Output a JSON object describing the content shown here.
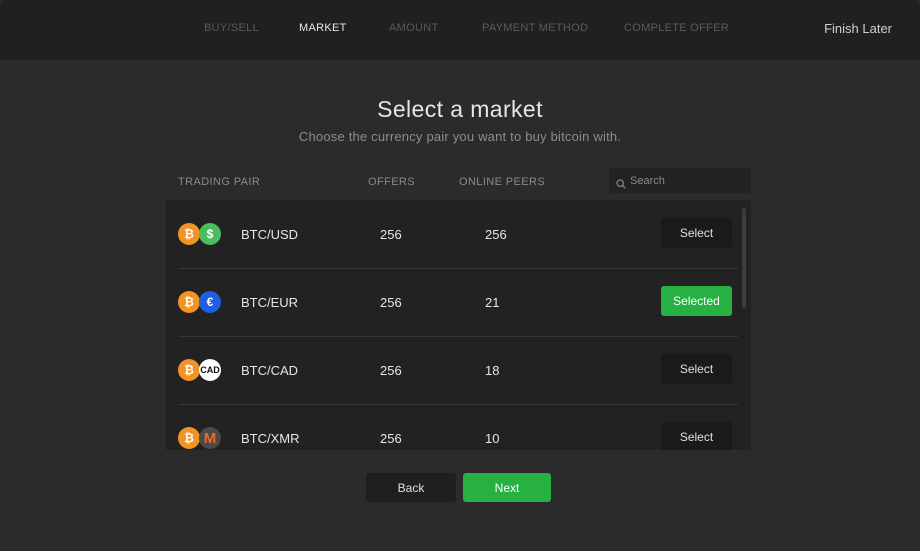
{
  "steps": [
    "BUY/SELL",
    "MARKET",
    "AMOUNT",
    "PAYMENT METHOD",
    "COMPLETE OFFER"
  ],
  "active_step": 1,
  "finish_later": "Finish Later",
  "title": "Select a market",
  "subtitle": "Choose the currency pair you want to buy bitcoin with.",
  "table": {
    "headers": {
      "pair": "TRADING PAIR",
      "offers": "OFFERS",
      "peers": "ONLINE PEERS"
    },
    "search_placeholder": "Search",
    "rows": [
      {
        "pair": "BTC/USD",
        "offers": "256",
        "peers": "256",
        "button": "Select",
        "selected": false,
        "icon": "usd-icon"
      },
      {
        "pair": "BTC/EUR",
        "offers": "256",
        "peers": "21",
        "button": "Selected",
        "selected": true,
        "icon": "eur-icon"
      },
      {
        "pair": "BTC/CAD",
        "offers": "256",
        "peers": "18",
        "button": "Select",
        "selected": false,
        "icon": "cad-icon"
      },
      {
        "pair": "BTC/XMR",
        "offers": "256",
        "peers": "10",
        "button": "Select",
        "selected": false,
        "icon": "xmr-icon"
      }
    ]
  },
  "coin_glyphs": {
    "btc": "₿",
    "usd": "$",
    "eur": "€",
    "cad": "CAD",
    "xmr": "M"
  },
  "colors": {
    "accent_green": "#27b142",
    "btc_orange": "#f29425",
    "usd_green": "#4dbb5f",
    "eur_blue": "#1d5fe0",
    "xmr_orange": "#f26822"
  },
  "footer": {
    "back": "Back",
    "next": "Next"
  }
}
